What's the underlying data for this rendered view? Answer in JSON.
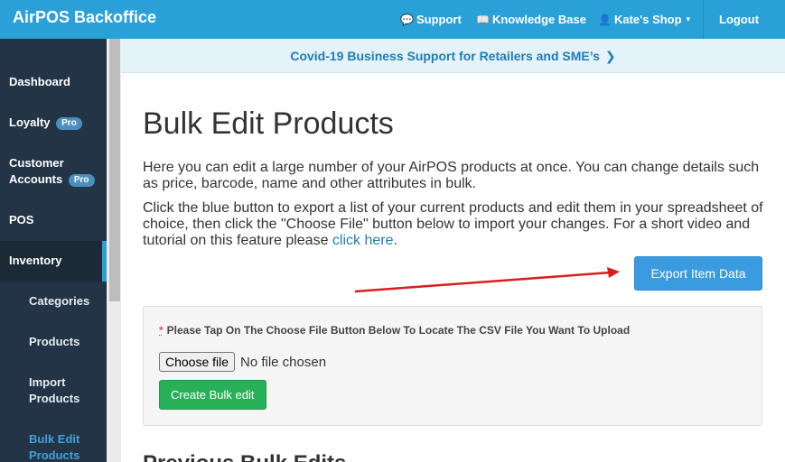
{
  "app": {
    "title": "AirPOS Backoffice",
    "accent_color": "#2aa0d9"
  },
  "topnav": {
    "support": {
      "label": "Support",
      "icon": "chat-bubbles-icon"
    },
    "knowledge_base": {
      "label": "Knowledge Base",
      "icon": "book-icon"
    },
    "shop": {
      "label": "Kate's Shop",
      "icon": "user-icon",
      "caret": "chevron-down-icon"
    },
    "logout": {
      "label": "Logout"
    }
  },
  "sidebar": {
    "items": [
      {
        "label": "Dashboard"
      },
      {
        "label": "Loyalty",
        "badge": "Pro"
      },
      {
        "label": "Customer Accounts",
        "line1": "Customer",
        "line2": "Accounts",
        "badge": "Pro"
      },
      {
        "label": "POS"
      },
      {
        "label": "Inventory",
        "active_section": true
      },
      {
        "label": "Categories"
      },
      {
        "label": "Products"
      },
      {
        "label": "Import Products",
        "line1": "Import",
        "line2": "Products"
      },
      {
        "label": "Bulk Edit Products",
        "line1": "Bulk Edit",
        "line2": "Products",
        "active": true
      }
    ]
  },
  "banner": {
    "text": "Covid-19 Business Support for Retailers and SME’s",
    "icon": "chevron-right-icon"
  },
  "main": {
    "title": "Bulk Edit Products",
    "intro": "Here you can edit a large number of your AirPOS products at once. You can change details such as price, barcode, name and other attributes in bulk.",
    "instructions": "Click the blue button to export a list of your current products and edit them in your spreadsheet of choice, then click the \"Choose File\" button below to import your changes. For a short video and tutorial on this feature please ",
    "link_text": "click here",
    "after_link": ".",
    "export_button": "Export Item Data",
    "upload": {
      "required_mark": "*",
      "label": "Please Tap On The Choose File Button Below To Locate The CSV File You Want To Upload",
      "choose_button": "Choose file",
      "file_status": "No file chosen",
      "submit_button": "Create Bulk edit"
    },
    "previous_heading": "Previous Bulk Edits"
  }
}
